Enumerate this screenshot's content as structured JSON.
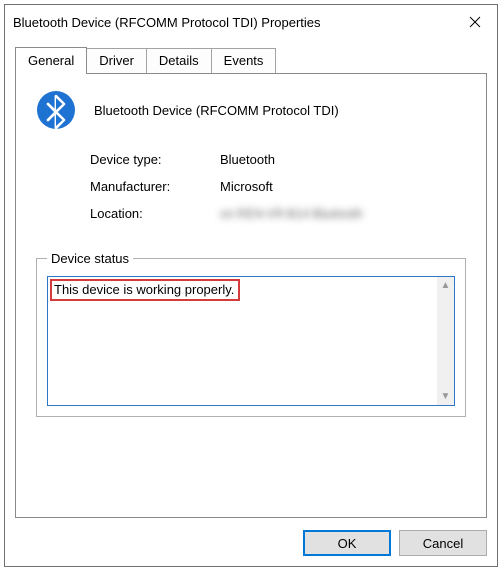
{
  "window": {
    "title": "Bluetooth Device (RFCOMM Protocol TDI) Properties"
  },
  "tabs": {
    "general": "General",
    "driver": "Driver",
    "details": "Details",
    "events": "Events"
  },
  "device": {
    "name": "Bluetooth Device (RFCOMM Protocol TDI)",
    "type_label": "Device type:",
    "type_value": "Bluetooth",
    "manufacturer_label": "Manufacturer:",
    "manufacturer_value": "Microsoft",
    "location_label": "Location:",
    "location_value": "on REN-VR-B14 Bluetooth"
  },
  "status": {
    "legend": "Device status",
    "text": "This device is working properly."
  },
  "buttons": {
    "ok": "OK",
    "cancel": "Cancel"
  }
}
